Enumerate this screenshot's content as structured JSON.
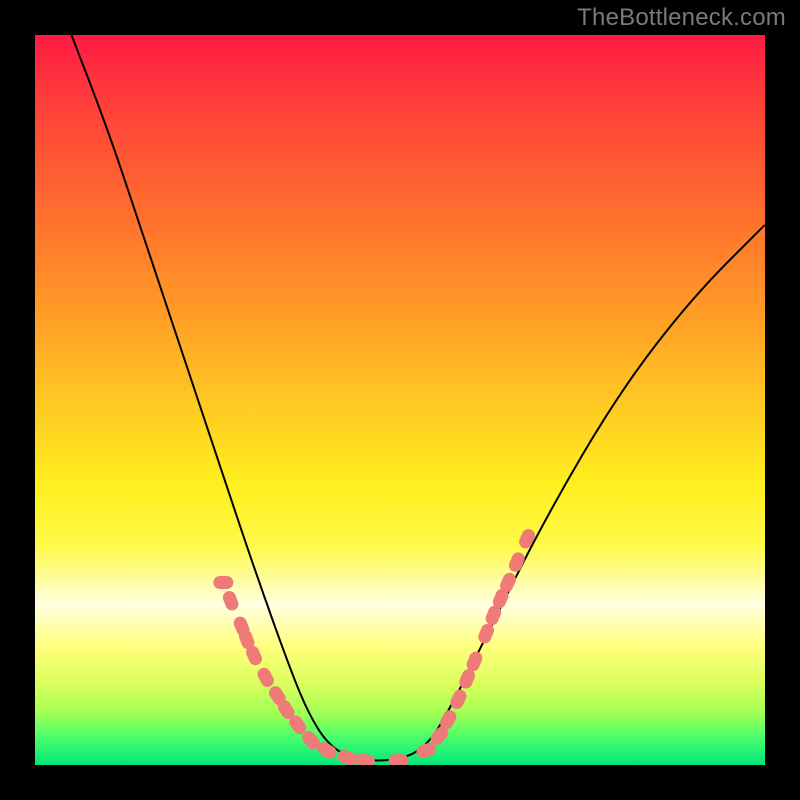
{
  "watermark": "TheBottleneck.com",
  "chart_data": {
    "type": "line",
    "title": "",
    "xlabel": "",
    "ylabel": "",
    "xlim": [
      0,
      1
    ],
    "ylim": [
      0,
      1
    ],
    "background_gradient": {
      "top_color": "#ff1a44",
      "bottom_color": "#00e87a",
      "description": "vertical gradient red→orange→yellow→green"
    },
    "series": [
      {
        "name": "bottleneck-curve",
        "color": "#000000",
        "stroke_width": 2,
        "x": [
          0.05,
          0.1,
          0.15,
          0.2,
          0.25,
          0.3,
          0.35,
          0.375,
          0.4,
          0.43,
          0.47,
          0.51,
          0.54,
          0.57,
          0.62,
          0.7,
          0.8,
          0.9,
          1.0
        ],
        "values": [
          1.0,
          0.87,
          0.72,
          0.57,
          0.42,
          0.27,
          0.13,
          0.07,
          0.03,
          0.01,
          0.005,
          0.01,
          0.03,
          0.08,
          0.18,
          0.34,
          0.51,
          0.64,
          0.74
        ]
      },
      {
        "name": "highlight-dots",
        "color": "#ee7b78",
        "marker": "rounded-dash",
        "x": [
          0.258,
          0.268,
          0.283,
          0.29,
          0.3,
          0.316,
          0.332,
          0.344,
          0.36,
          0.378,
          0.4,
          0.428,
          0.452,
          0.498,
          0.536,
          0.554,
          0.566,
          0.58,
          0.592,
          0.602,
          0.618,
          0.628,
          0.638,
          0.648,
          0.66,
          0.674
        ],
        "values": [
          0.25,
          0.225,
          0.19,
          0.172,
          0.15,
          0.12,
          0.095,
          0.076,
          0.055,
          0.034,
          0.02,
          0.01,
          0.006,
          0.006,
          0.02,
          0.04,
          0.062,
          0.09,
          0.118,
          0.142,
          0.18,
          0.205,
          0.228,
          0.25,
          0.278,
          0.31
        ]
      }
    ]
  }
}
